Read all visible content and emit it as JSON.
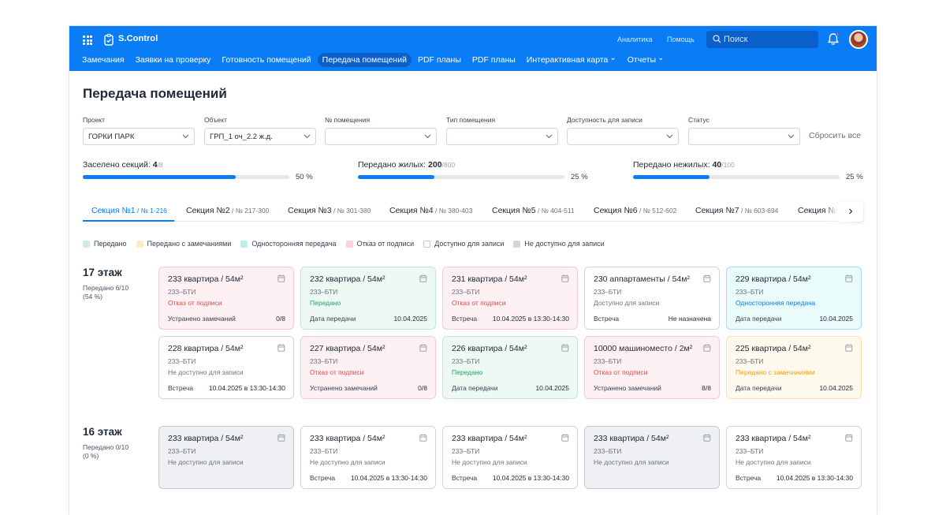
{
  "header": {
    "app_name": "S.Control",
    "links": [
      "Аналитика",
      "Помощь"
    ],
    "search_placeholder": "Поиск",
    "nav": [
      {
        "label": "Замечания",
        "dropdown": false,
        "active": false
      },
      {
        "label": "Заявки на проверку",
        "dropdown": false,
        "active": false
      },
      {
        "label": "Готовность помещений",
        "dropdown": false,
        "active": false
      },
      {
        "label": "Передача помещений",
        "dropdown": false,
        "active": true
      },
      {
        "label": "PDF планы",
        "dropdown": false,
        "active": false
      },
      {
        "label": "PDF планы",
        "dropdown": false,
        "active": false
      },
      {
        "label": "Интерактивная карта",
        "dropdown": true,
        "active": false
      },
      {
        "label": "Отчеты",
        "dropdown": true,
        "active": false
      }
    ]
  },
  "page": {
    "title": "Передача помещений"
  },
  "filters": [
    {
      "label": "Проект",
      "value": "ГОРКИ ПАРК"
    },
    {
      "label": "Объект",
      "value": "ГРП_1 оч_2.2 ж.д."
    },
    {
      "label": "№ помещения",
      "value": ""
    },
    {
      "label": "Тип помещения",
      "value": ""
    },
    {
      "label": "Доступность для записи",
      "value": ""
    },
    {
      "label": "Статус",
      "value": ""
    }
  ],
  "reset_label": "Сбросить все",
  "progress": [
    {
      "label": "Заселено секций:",
      "value": "4",
      "total": "/8",
      "percent": 50,
      "percent_text": "50 %"
    },
    {
      "label": "Передано жилых:",
      "value": "200",
      "total": "/800",
      "percent": 25,
      "percent_text": "25 %"
    },
    {
      "label": "Передано нежилых:",
      "value": "40",
      "total": "/100",
      "percent": 25,
      "percent_text": "25 %"
    }
  ],
  "tabs": [
    {
      "name": "Секция №1",
      "range": " / № 1-216",
      "active": true
    },
    {
      "name": "Секция №2",
      "range": " / № 217-300",
      "active": false
    },
    {
      "name": "Секция №3",
      "range": " / № 301-380",
      "active": false
    },
    {
      "name": "Секция №4",
      "range": " / № 380-403",
      "active": false
    },
    {
      "name": "Секция №5",
      "range": " / № 404-511",
      "active": false
    },
    {
      "name": "Секция №6",
      "range": " / № 512-602",
      "active": false
    },
    {
      "name": "Секция №7",
      "range": " / № 603-694",
      "active": false
    },
    {
      "name": "Секция №",
      "range": "",
      "active": false
    }
  ],
  "legend": [
    {
      "label": "Передано",
      "color": "#c9eedd",
      "border": "#c9eedd"
    },
    {
      "label": "Передано с замечаниями",
      "color": "#fde9c6",
      "border": "#fde9c6"
    },
    {
      "label": "Односторонняя передача",
      "color": "#bdeef0",
      "border": "#bdeef0"
    },
    {
      "label": "Отказ от подписи",
      "color": "#f9d3d9",
      "border": "#f9d3d9"
    },
    {
      "label": "Доступно для записи",
      "color": "#ffffff",
      "border": "#c5c9cf"
    },
    {
      "label": "Не доступно для записи",
      "color": "#d1d5db",
      "border": "#d1d5db"
    }
  ],
  "status_colors": {
    "green": "#1fa36a",
    "red": "#e5484d",
    "teal": "#0a7cf5",
    "orange": "#f59e0b",
    "grey": "#6b7280"
  },
  "floors": [
    {
      "title": "17 этаж",
      "sub1": "Передано 6/10",
      "sub2": "(54 %)",
      "cards": [
        {
          "title": "233 квартира / 54м²",
          "bti": "233–БТИ",
          "status": "Отказ от подписи",
          "tone": "red",
          "foot_l": "Устранено замечаний",
          "foot_r": "0/8"
        },
        {
          "title": "232 квартира / 54м²",
          "bti": "233–БТИ",
          "status": "Передано",
          "tone": "green",
          "foot_l": "Дата передачи",
          "foot_r": "10.04.2025"
        },
        {
          "title": "231 квартира / 54м²",
          "bti": "233–БТИ",
          "status": "Отказ от подписи",
          "tone": "red",
          "foot_l": "Встреча",
          "foot_r": "10.04.2025 в 13:30-14:30"
        },
        {
          "title": "230 аппартаменты / 54м²",
          "bti": "233–БТИ",
          "status": "Доступно для записи",
          "tone": "white",
          "foot_l": "Встреча",
          "foot_r": "Не назначена"
        },
        {
          "title": "229 квартира / 54м²",
          "bti": "233–БТИ",
          "status": "Односторонняя передача",
          "tone": "teal",
          "foot_l": "Дата передачи",
          "foot_r": "10.04.2025"
        },
        {
          "title": "228 квартира / 54м²",
          "bti": "233–БТИ",
          "status": "Не доступно для записи",
          "tone": "white",
          "foot_l": "Встреча",
          "foot_r": "10.04.2025 в 13:30-14:30"
        },
        {
          "title": "227 квартира / 54м²",
          "bti": "233–БТИ",
          "status": "Отказ от подписи",
          "tone": "red",
          "foot_l": "Устранено замечаний",
          "foot_r": "0/8"
        },
        {
          "title": "226 квартира / 54м²",
          "bti": "233–БТИ",
          "status": "Передано",
          "tone": "green",
          "foot_l": "Дата передачи",
          "foot_r": "10.04.2025"
        },
        {
          "title": "10000 машиноместо / 2м²",
          "bti": "233–БТИ",
          "status": "Отказ от подписи",
          "tone": "red",
          "foot_l": "Устранено замечаний",
          "foot_r": "8/8"
        },
        {
          "title": "225 квартира / 54м²",
          "bti": "233–БТИ",
          "status": "Передано с замечаниями",
          "tone": "orange",
          "foot_l": "Дата передачи",
          "foot_r": "10.04.2025"
        }
      ]
    },
    {
      "title": "16 этаж",
      "sub1": "Передано 0/10",
      "sub2": "(0 %)",
      "cards": [
        {
          "title": "233 квартира / 54м²",
          "bti": "233–БТИ",
          "status": "Не доступно для записи",
          "tone": "grey",
          "foot_l": "",
          "foot_r": ""
        },
        {
          "title": "233 квартира / 54м²",
          "bti": "233–БТИ",
          "status": "Не доступно для записи",
          "tone": "white",
          "foot_l": "Встреча",
          "foot_r": "10.04.2025 в 13:30-14:30"
        },
        {
          "title": "233 квартира / 54м²",
          "bti": "233–БТИ",
          "status": "Не доступно для записи",
          "tone": "white",
          "foot_l": "Встреча",
          "foot_r": "10.04.2025 в 13:30-14:30"
        },
        {
          "title": "233 квартира / 54м²",
          "bti": "233–БТИ",
          "status": "Не доступно для записи",
          "tone": "grey",
          "foot_l": "",
          "foot_r": ""
        },
        {
          "title": "233 квартира / 54м²",
          "bti": "233–БТИ",
          "status": "Не доступно для записи",
          "tone": "white",
          "foot_l": "Встреча",
          "foot_r": "10.04.2025 в 13:30-14:30"
        }
      ]
    }
  ]
}
